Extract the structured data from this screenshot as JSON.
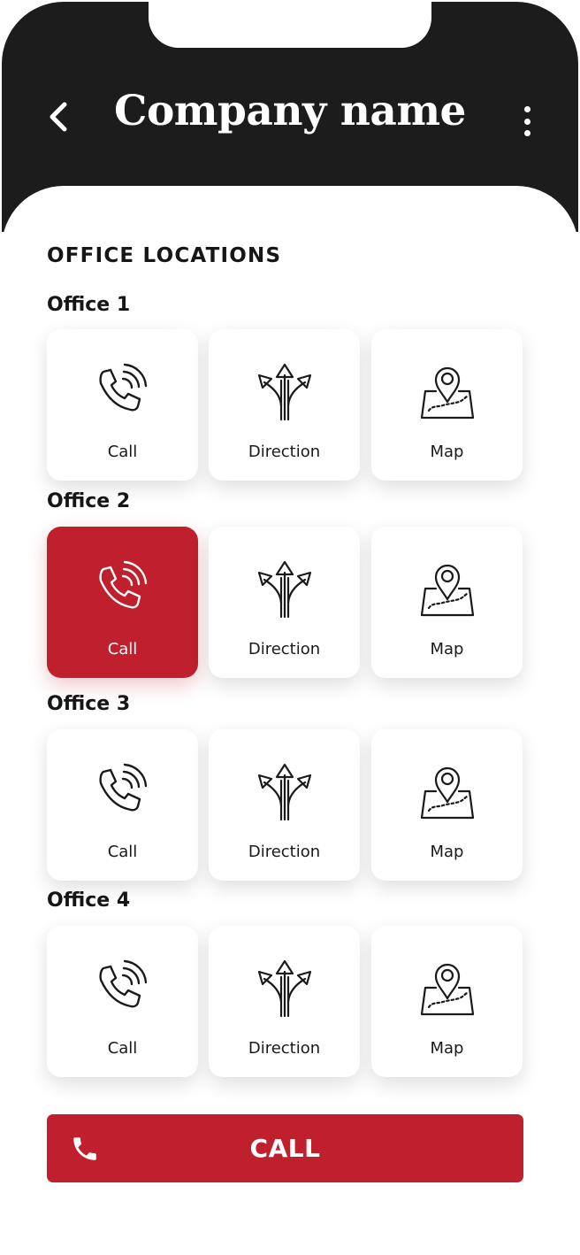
{
  "header": {
    "title": "Company name",
    "back_icon": "chevron-left-icon",
    "menu_icon": "more-vertical-icon"
  },
  "section_title": "OFFICE LOCATIONS",
  "offices": [
    {
      "label": "Office 1",
      "actions": [
        {
          "label": "Call",
          "icon": "phone-ringing-icon",
          "active": false
        },
        {
          "label": "Direction",
          "icon": "direction-arrows-icon",
          "active": false
        },
        {
          "label": "Map",
          "icon": "map-pin-icon",
          "active": false
        }
      ]
    },
    {
      "label": "Office 2",
      "actions": [
        {
          "label": "Call",
          "icon": "phone-ringing-icon",
          "active": true
        },
        {
          "label": "Direction",
          "icon": "direction-arrows-icon",
          "active": false
        },
        {
          "label": "Map",
          "icon": "map-pin-icon",
          "active": false
        }
      ]
    },
    {
      "label": "Office 3",
      "actions": [
        {
          "label": "Call",
          "icon": "phone-ringing-icon",
          "active": false
        },
        {
          "label": "Direction",
          "icon": "direction-arrows-icon",
          "active": false
        },
        {
          "label": "Map",
          "icon": "map-pin-icon",
          "active": false
        }
      ]
    },
    {
      "label": "Office 4",
      "actions": [
        {
          "label": "Call",
          "icon": "phone-ringing-icon",
          "active": false
        },
        {
          "label": "Direction",
          "icon": "direction-arrows-icon",
          "active": false
        },
        {
          "label": "Map",
          "icon": "map-pin-icon",
          "active": false
        }
      ]
    }
  ],
  "call_button": {
    "label": "CALL",
    "icon": "phone-icon"
  },
  "colors": {
    "accent": "#c01f2d",
    "header_bg": "#1c1c1c",
    "text": "#161616",
    "tile_bg": "#ffffff"
  }
}
